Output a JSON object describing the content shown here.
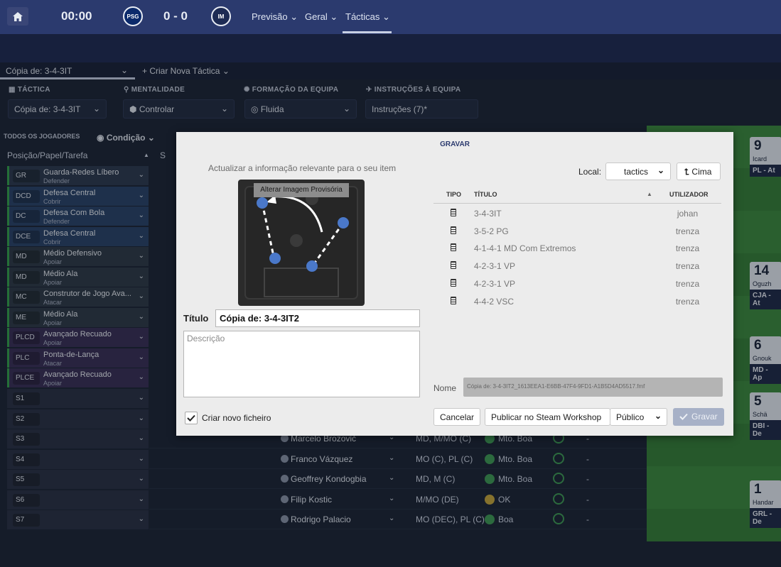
{
  "topbar": {
    "clock": "00:00",
    "score": "0 - 0",
    "home_crest": "PSG",
    "away_crest": "IM",
    "nav": [
      "Previsão",
      "Geral",
      "Tácticas"
    ]
  },
  "tactic_bar": {
    "current_tab": "Cópia de: 3-4-3IT",
    "new_tactic": "Criar Nova Táctica"
  },
  "controls": {
    "tactic_label": "TÁCTICA",
    "tactic_value": "Cópia de: 3-4-3IT",
    "mentality_label": "MENTALIDADE",
    "mentality_value": "Controlar",
    "formation_label": "FORMAÇÃO DA EQUIPA",
    "formation_value": "Fluida",
    "instructions_label": "INSTRUÇÕES À EQUIPA",
    "instructions_value": "Instruções (7)*"
  },
  "list": {
    "all_players": "TODOS OS JOGADORES",
    "condition": "Condição",
    "header": "Posição/Papel/Tarefa",
    "col_s": "S",
    "positions": [
      {
        "pos": "GR",
        "role": "Guarda-Redes Líbero",
        "duty": "Defender",
        "color": "#2d3a4e"
      },
      {
        "pos": "DCD",
        "role": "Defesa Central",
        "duty": "Cobrir",
        "color": "#2a4368"
      },
      {
        "pos": "DC",
        "role": "Defesa Com Bola",
        "duty": "Defender",
        "color": "#2a4368"
      },
      {
        "pos": "DCE",
        "role": "Defesa Central",
        "duty": "Cobrir",
        "color": "#2a4368"
      },
      {
        "pos": "MD",
        "role": "Médio Defensivo",
        "duty": "Apoiar",
        "color": "#2f3a46"
      },
      {
        "pos": "MD",
        "role": "Médio Ala",
        "duty": "Apoiar",
        "color": "#2f3a46"
      },
      {
        "pos": "MC",
        "role": "Construtor de Jogo Ava...",
        "duty": "Atacar",
        "color": "#2f3a46"
      },
      {
        "pos": "ME",
        "role": "Médio Ala",
        "duty": "Apoiar",
        "color": "#2f3a46"
      },
      {
        "pos": "PLCD",
        "role": "Avançado Recuado",
        "duty": "Apoiar",
        "color": "#3a2f55"
      },
      {
        "pos": "PLC",
        "role": "Ponta-de-Lança",
        "duty": "Atacar",
        "color": "#3a2f55"
      },
      {
        "pos": "PLCE",
        "role": "Avançado Recuado",
        "duty": "Apoiar",
        "color": "#3a2f55"
      }
    ],
    "subs": [
      "S1",
      "S2",
      "S3",
      "S4",
      "S5",
      "S6",
      "S7"
    ],
    "sub_players": [
      {
        "name": "Marcelo Brozović",
        "pos": "MD, M/MO (C)",
        "fit": "Mto. Boa",
        "ok": false
      },
      {
        "name": "Franco Vázquez",
        "pos": "MO (C), PL (C)",
        "fit": "Mto. Boa",
        "ok": false
      },
      {
        "name": "Geoffrey Kondogbia",
        "pos": "MD, M (C)",
        "fit": "Mto. Boa",
        "ok": false
      },
      {
        "name": "Filip Kostic",
        "pos": "M/MO (DE)",
        "fit": "OK",
        "ok": true
      },
      {
        "name": "Rodrigo Palacio",
        "pos": "MO (DEC), PL (C)",
        "fit": "Boa",
        "ok": false
      }
    ],
    "dash": "-"
  },
  "pitch": {
    "cards": [
      {
        "num": "9",
        "name": "Icard",
        "role": "PL - At"
      },
      {
        "num": "14",
        "name": "Oguzh",
        "role": "CJA - At"
      },
      {
        "num": "6",
        "name": "Gnouk",
        "role": "MD - Ap"
      },
      {
        "num": "5",
        "name": "Schä",
        "role": "DBI - De"
      },
      {
        "num": "1",
        "name": "Handar",
        "role": "GRL - De"
      }
    ]
  },
  "modal": {
    "title": "GRAVAR",
    "subtitle": "Actualizar a informação relevante para o seu item",
    "change_image": "Alterar Imagem Provisória",
    "title_label": "Título",
    "title_value": "Cópia de: 3-4-3IT2",
    "description_placeholder": "Descrição",
    "create_new_file": "Criar novo ficheiro",
    "create_new_checked": true,
    "local_label": "Local:",
    "local_value": "tactics",
    "up_button": "Cima",
    "columns": {
      "tipo": "TIPO",
      "titulo": "TÍTULO",
      "utilizador": "UTILIZADOR"
    },
    "files": [
      {
        "title": "3-4-3IT",
        "user": "johan"
      },
      {
        "title": "3-5-2 PG",
        "user": "trenza"
      },
      {
        "title": "4-1-4-1 MD Com Extremos",
        "user": "trenza"
      },
      {
        "title": "4-2-3-1 VP",
        "user": "trenza"
      },
      {
        "title": "4-2-3-1 VP",
        "user": "trenza"
      },
      {
        "title": "4-4-2 VSC",
        "user": "trenza"
      }
    ],
    "name_label": "Nome",
    "name_value": "Cópia de: 3-4-3IT2_1613EEA1-E6BB-47F4-9FD1-A1B5D4AD5517.fmf",
    "cancel": "Cancelar",
    "publish": "Publicar no Steam Workshop",
    "visibility": "Público",
    "save": "Gravar"
  },
  "colors": {
    "accent": "#2b3a6e",
    "green": "#35a34a"
  }
}
